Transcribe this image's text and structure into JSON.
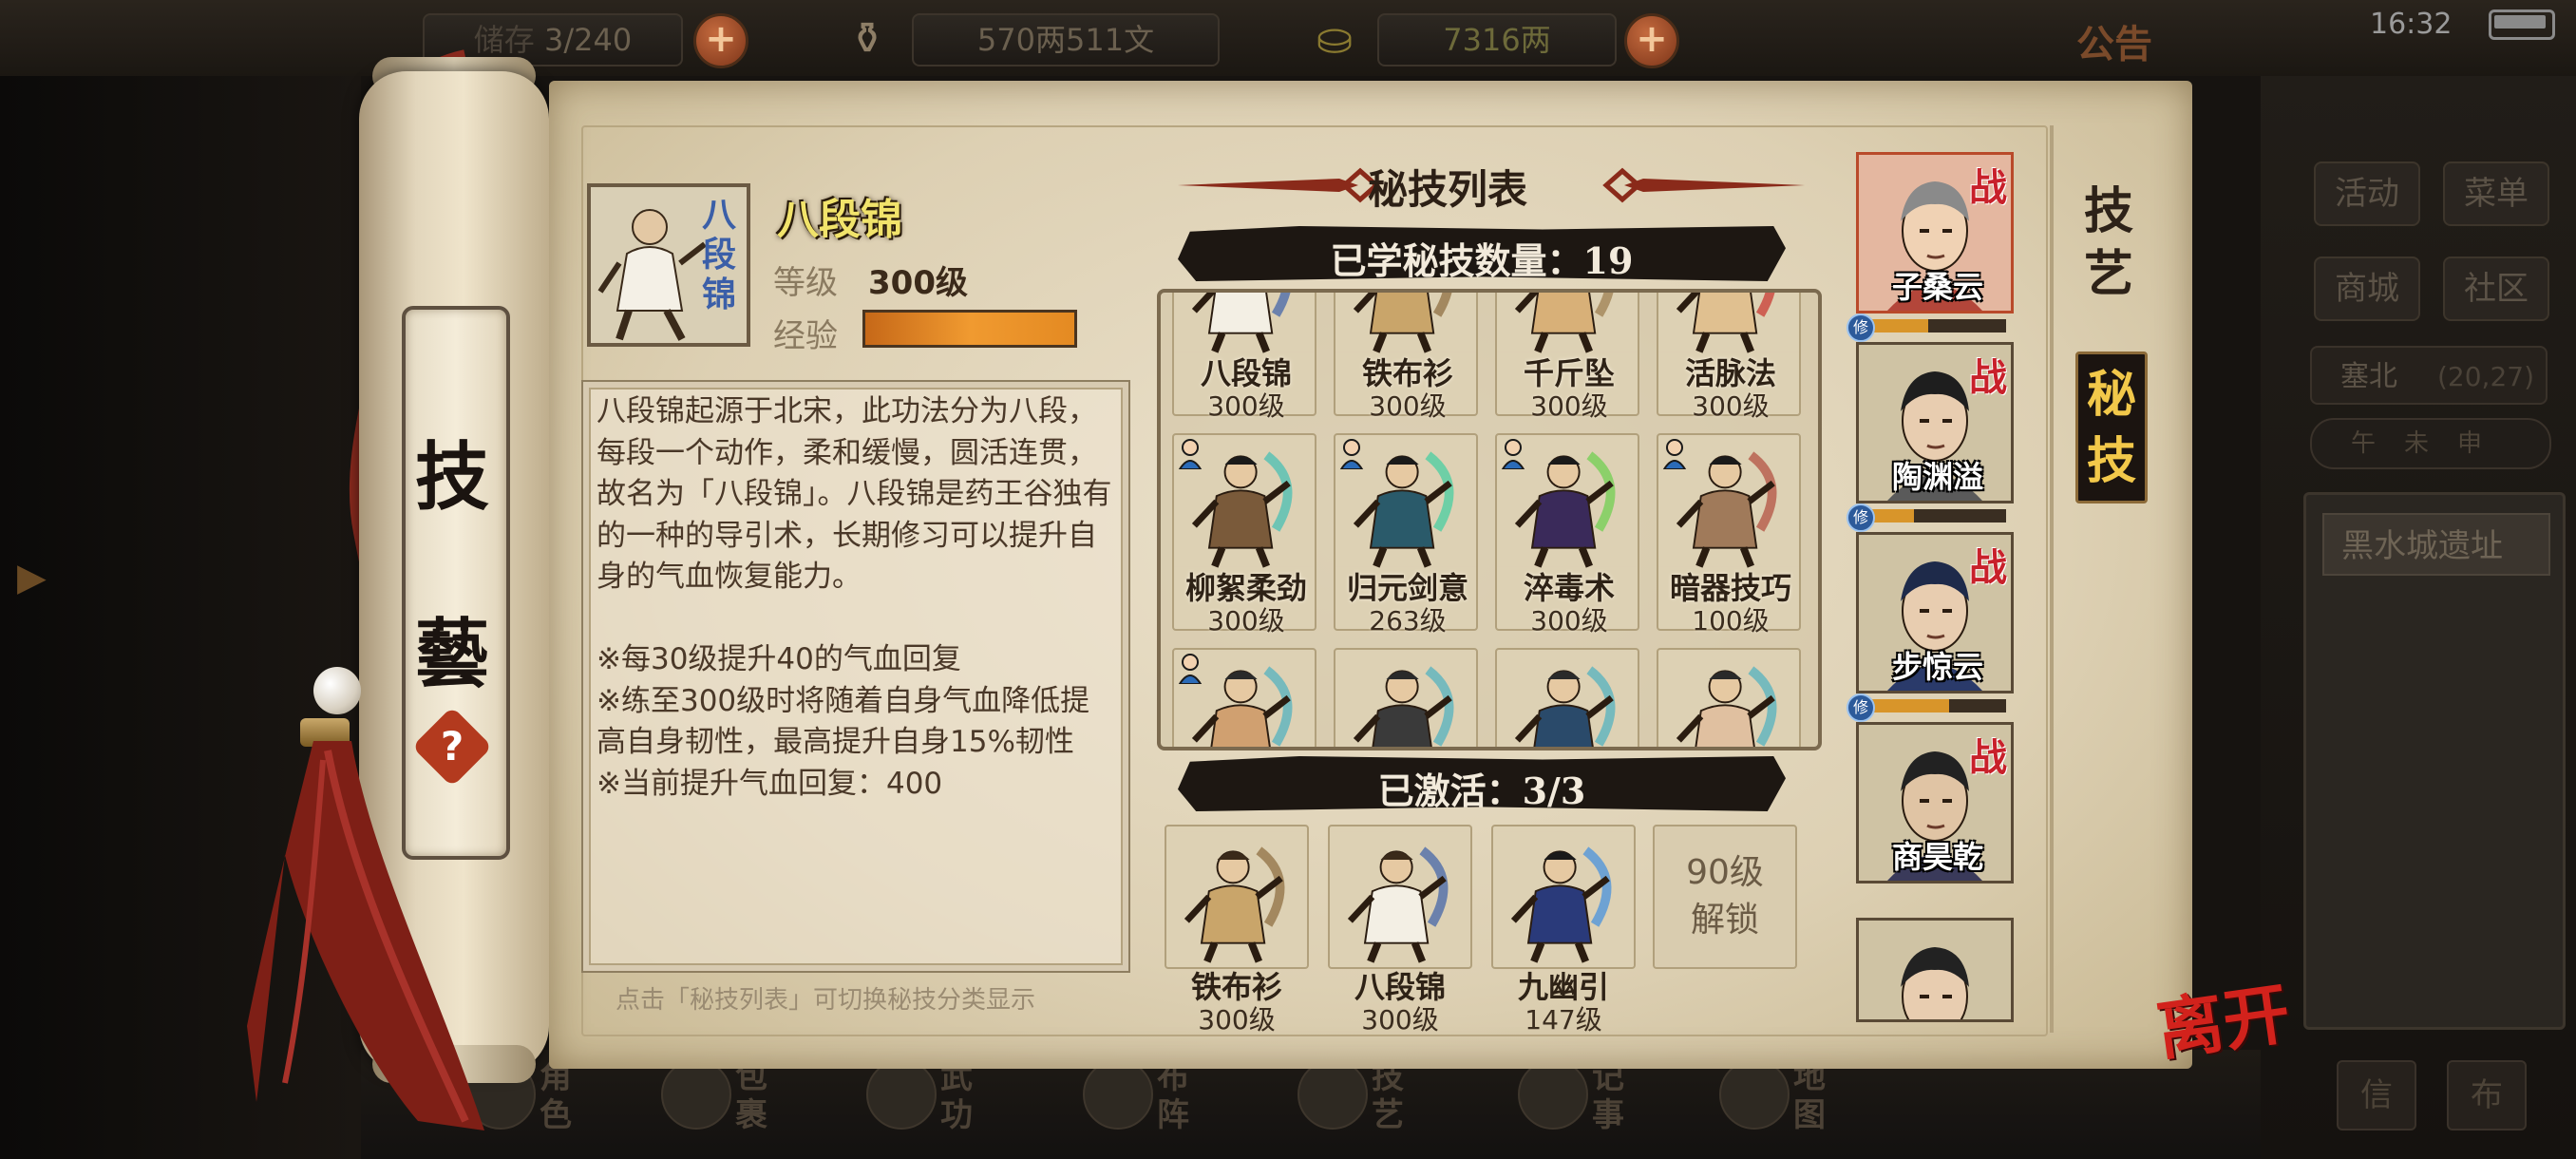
{
  "top_bar": {
    "slot_text": "3/240",
    "slot_label": "储存",
    "copper": "570两511文",
    "gold": "7316两",
    "notice": "公告",
    "clock": "16:32"
  },
  "scroll": {
    "title_char_1": "技",
    "title_char_2": "藝",
    "help": "?"
  },
  "skill_detail": {
    "name": "八段锦",
    "icon_text": "八段锦",
    "level_label": "等级",
    "level_value": "300级",
    "exp_label": "经验",
    "exp_fraction": 1.0,
    "description": "八段锦起源于北宋，此功法分为八段，每段一个动作，柔和缓慢，圆活连贯，故名为「八段锦」。八段锦是药王谷独有的一种的导引术，长期修习可以提升自身的气血恢复能力。\n\n※每30级提升40的气血回复\n※练至300级时将随着自身气血降低提高自身韧性，最高提升自身15%韧性\n※当前提升气血回复：400",
    "hint": "点击「秘技列表」可切换秘技分类显示"
  },
  "list_panel": {
    "title": "秘技列表",
    "learned_label": "已学秘技数量：19",
    "active_label": "已激活：3/3"
  },
  "skills": [
    {
      "name": "八段锦",
      "level": "300级",
      "hair": "#3a2a1a",
      "robe": "#f3efe4",
      "accent": "#3b5fa8"
    },
    {
      "name": "铁布衫",
      "level": "300级",
      "hair": "#3a2a1a",
      "robe": "#c9a56a",
      "accent": "#8a6a3a"
    },
    {
      "name": "千斤坠",
      "level": "300级",
      "hair": "#3a2a1a",
      "robe": "#d8b078",
      "accent": "#9a7a4a"
    },
    {
      "name": "活脉法",
      "level": "300级",
      "hair": "#3a2a1a",
      "robe": "#e0c090",
      "accent": "#c8302a"
    },
    {
      "name": "柳絮柔劲",
      "level": "300级",
      "hair": "#1a1a1a",
      "robe": "#7a5a3a",
      "accent": "#3fbfb3"
    },
    {
      "name": "归元剑意",
      "level": "263级",
      "hair": "#1a1a1a",
      "robe": "#2a5a6a",
      "accent": "#3fcf9f"
    },
    {
      "name": "淬毒术",
      "level": "300级",
      "hair": "#1a1a1a",
      "robe": "#3a2a5a",
      "accent": "#6ad04a"
    },
    {
      "name": "暗器技巧",
      "level": "100级",
      "hair": "#1a1a1a",
      "robe": "#a07a5a",
      "accent": "#b04a3a"
    },
    {
      "name": "",
      "level": "",
      "hair": "#2a2a2a",
      "robe": "#d0a070",
      "accent": "#4ab0c0"
    },
    {
      "name": "",
      "level": "",
      "hair": "#2a2a2a",
      "robe": "#3a3a3a",
      "accent": "#4ab0c0"
    },
    {
      "name": "",
      "level": "",
      "hair": "#2a2a2a",
      "robe": "#2a4a6a",
      "accent": "#4ab0c0"
    },
    {
      "name": "",
      "level": "",
      "hair": "#2a2a2a",
      "robe": "#e0c0a0",
      "accent": "#4ab0c0"
    }
  ],
  "active_skills": [
    {
      "name": "铁布衫",
      "level": "300级"
    },
    {
      "name": "八段锦",
      "level": "300级"
    },
    {
      "name": "九幽引",
      "level": "147级"
    }
  ],
  "unlock_text": "90级\n解锁",
  "characters": [
    {
      "name": "子桑云",
      "zhan": "战",
      "bar_fraction": 0.45
    },
    {
      "name": "陶渊溢",
      "zhan": "战",
      "bar_fraction": 0.35
    },
    {
      "name": "步惊云",
      "zhan": "战",
      "bar_fraction": 0.6
    },
    {
      "name": "商昊乾",
      "zhan": "战",
      "bar_fraction": 0
    },
    {
      "name": "",
      "zhan": "",
      "bar_fraction": 0
    }
  ],
  "xiu_badge": "修",
  "tabs": {
    "jiyi": "技艺",
    "miji": "秘技"
  },
  "right_menu": {
    "huodong": "活动",
    "caidan": "菜单",
    "shangcheng": "商城",
    "shequ": "社区",
    "location": "塞北",
    "coords": "(20,27)",
    "time_marks": "午未申",
    "quest": "黑水城遗址",
    "btn_xin": "信",
    "btn_bu": "布"
  },
  "bottom_nav": [
    "角色",
    "包裹",
    "武功",
    "布阵",
    "技艺",
    "记事",
    "地图"
  ],
  "leave": "离开",
  "colors": {
    "accent_red": "#c8202a",
    "exp_orange": "#f09a30",
    "banner_dark": "#1d1712",
    "parchment": "#e2d7bf"
  }
}
